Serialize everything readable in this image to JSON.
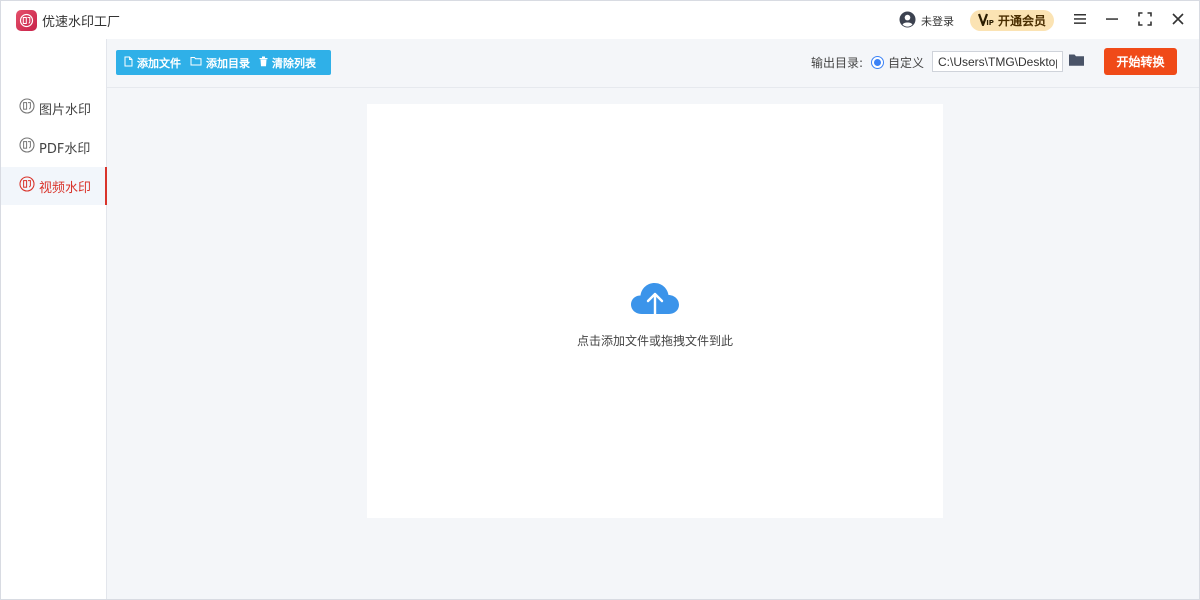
{
  "app": {
    "title": "优速水印工厂",
    "logo_icon": "app-logo-icon"
  },
  "header": {
    "user_status": "未登录",
    "vip_label": "开通会员",
    "vip_badge": "VIP"
  },
  "sidebar": {
    "items": [
      {
        "label": "图片水印",
        "icon": "watermark-stamp-icon",
        "active": false
      },
      {
        "label": "PDF水印",
        "icon": "watermark-stamp-icon",
        "active": false
      },
      {
        "label": "视频水印",
        "icon": "watermark-stamp-icon",
        "active": true
      }
    ]
  },
  "toolbar": {
    "add_file": "添加文件",
    "add_folder": "添加目录",
    "clear_list": "清除列表",
    "output_label": "输出目录:",
    "radio_label": "自定义",
    "output_path": "C:\\Users\\TMG\\Desktop",
    "start_button": "开始转换"
  },
  "dropzone": {
    "hint": "点击添加文件或拖拽文件到此"
  },
  "colors": {
    "accent_blue": "#2fb0e8",
    "start_orange": "#f04a18",
    "active_red": "#d9342b",
    "vip_gold": "#fbe3b3",
    "cloud_blue": "#3b94ea"
  }
}
